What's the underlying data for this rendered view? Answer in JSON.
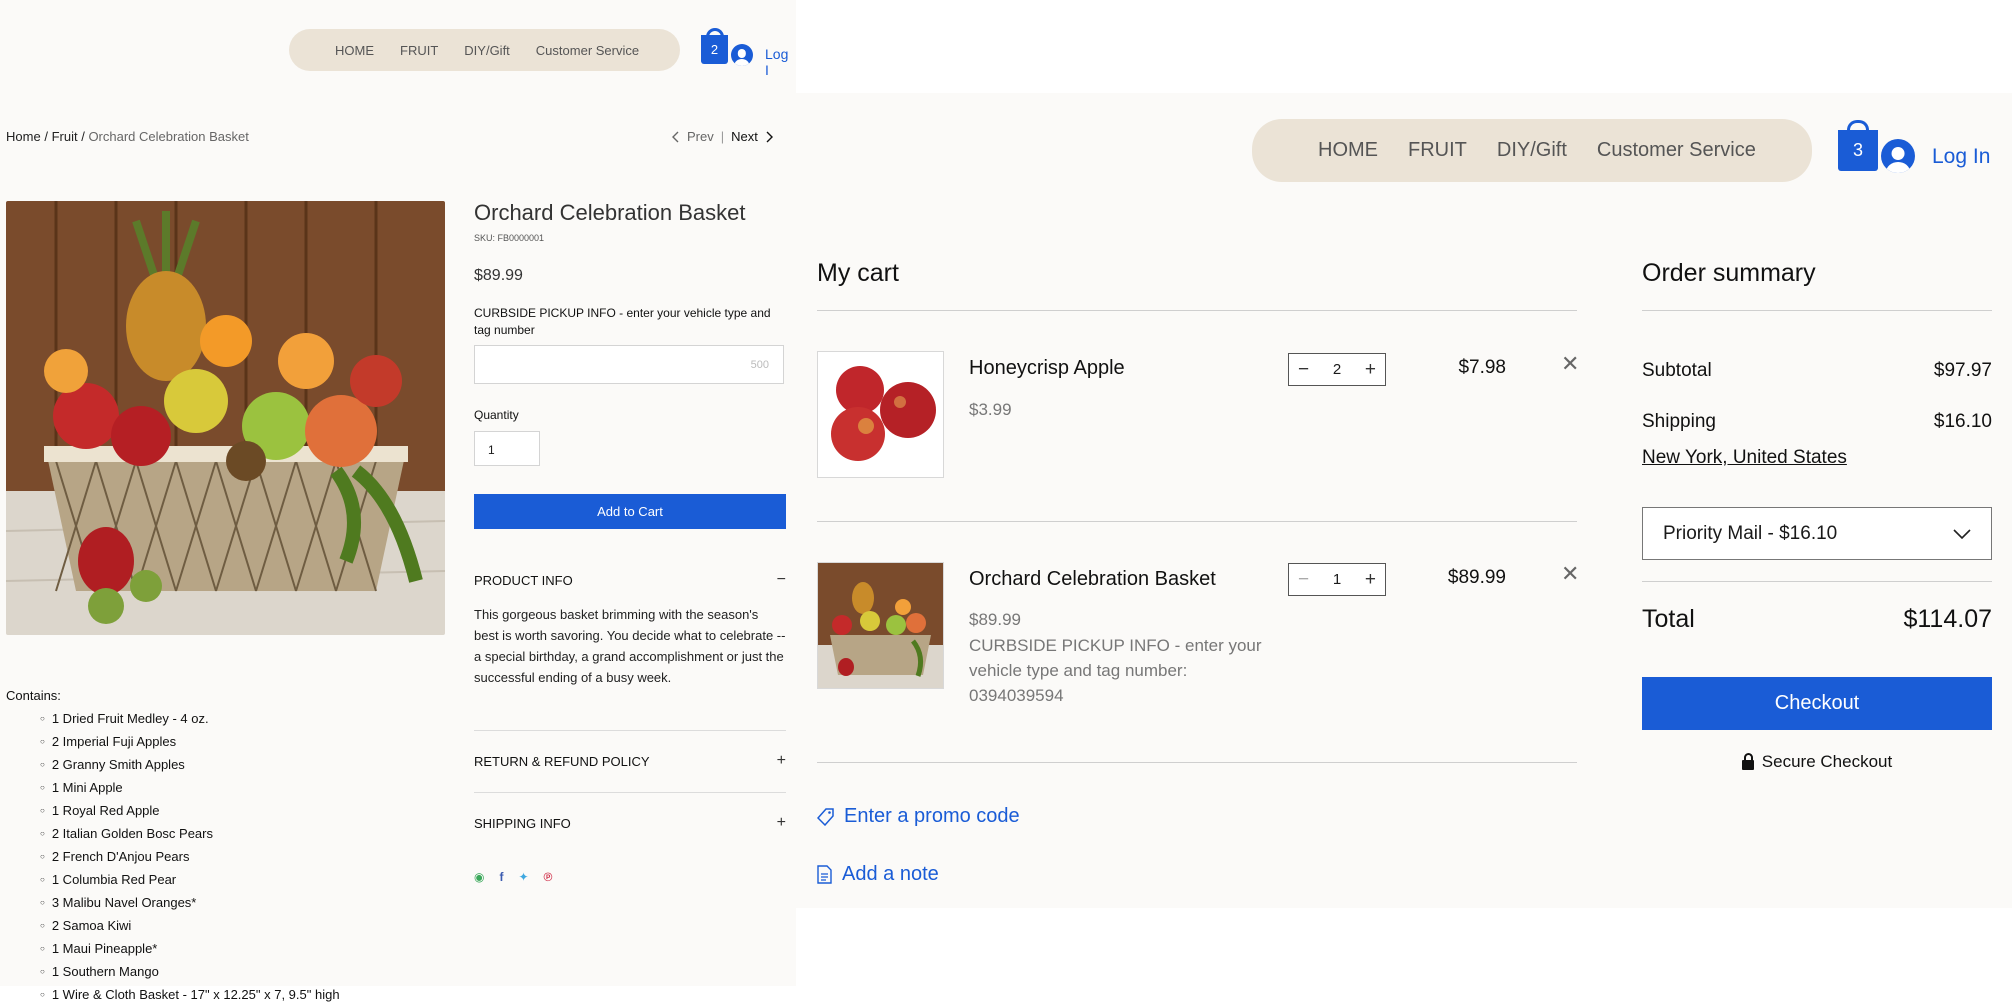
{
  "product_page": {
    "nav": [
      "HOME",
      "FRUIT",
      "DIY/Gift",
      "Customer Service"
    ],
    "cart_count": "2",
    "login": "Log I",
    "breadcrumb": {
      "home": "Home",
      "sep": "/",
      "fruit": "Fruit",
      "current": "Orchard Celebration Basket"
    },
    "prev": "Prev",
    "next": "Next",
    "title": "Orchard Celebration Basket",
    "sku": "SKU: FB0000001",
    "price": "$89.99",
    "pickup_label": "CURBSIDE PICKUP INFO - enter your vehicle type and tag number",
    "pickup_char_limit": "500",
    "quantity_label": "Quantity",
    "quantity_value": "1",
    "add_to_cart": "Add to Cart",
    "product_info_header": "PRODUCT INFO",
    "product_info_text": "This gorgeous basket brimming with the season's best is worth savoring. You decide what to celebrate -- a special birthday, a grand accomplishment or just the successful ending of a busy week.",
    "return_policy_header": "RETURN & REFUND POLICY",
    "shipping_info_header": "SHIPPING INFO",
    "contains_label": "Contains:",
    "contains": [
      "1 Dried Fruit Medley - 4 oz.",
      "2 Imperial Fuji Apples",
      "2 Granny Smith Apples",
      "1 Mini Apple",
      "1 Royal Red Apple",
      "2 Italian Golden Bosc Pears",
      "2 French D'Anjou Pears",
      "1 Columbia Red Pear",
      "3 Malibu Navel Oranges*",
      "2 Samoa Kiwi",
      "1 Maui Pineapple*",
      "1 Southern Mango",
      "1 Wire & Cloth Basket - 17\" x 12.25\" x 7, 9.5\" high"
    ]
  },
  "cart_page": {
    "nav": [
      "HOME",
      "FRUIT",
      "DIY/Gift",
      "Customer Service"
    ],
    "cart_count": "3",
    "login": "Log In",
    "cart_title": "My cart",
    "items": [
      {
        "name": "Honeycrisp Apple",
        "unit_price": "$3.99",
        "qty": "2",
        "total": "$7.98"
      },
      {
        "name": "Orchard Celebration Basket",
        "unit_price": "$89.99",
        "note": "CURBSIDE PICKUP INFO - enter your vehicle type and tag number: 0394039594",
        "qty": "1",
        "total": "$89.99"
      }
    ],
    "promo": "Enter a promo code",
    "add_note": "Add a note",
    "summary_title": "Order summary",
    "subtotal_label": "Subtotal",
    "subtotal": "$97.97",
    "shipping_label": "Shipping",
    "shipping": "$16.10",
    "location": "New York, United States",
    "shipping_option": "Priority Mail - $16.10",
    "total_label": "Total",
    "total": "$114.07",
    "checkout": "Checkout",
    "secure": "Secure Checkout"
  },
  "colors": {
    "accent": "#1a5cd6",
    "nav_pill": "#ebe3d6",
    "panel_bg": "#fbfaf8"
  },
  "icons": [
    "shopping-bag-icon",
    "user-avatar-icon",
    "chevron-left-icon",
    "chevron-right-icon",
    "minus-icon",
    "plus-icon",
    "close-icon",
    "tag-icon",
    "note-icon",
    "lock-icon",
    "chevron-down-icon",
    "whatsapp-icon",
    "facebook-icon",
    "twitter-icon",
    "pinterest-icon"
  ]
}
